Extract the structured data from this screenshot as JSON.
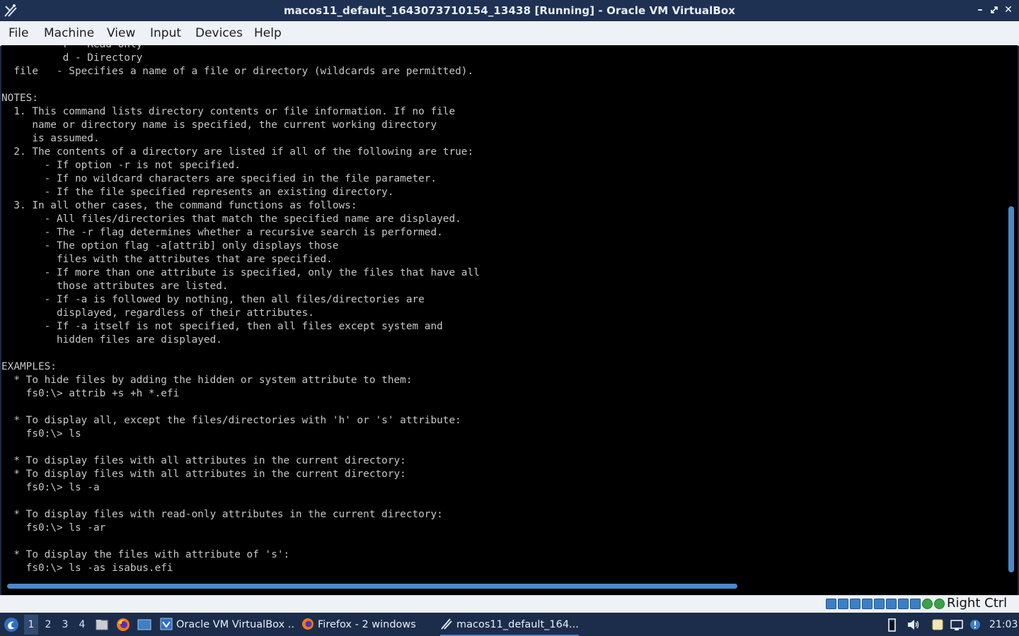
{
  "window": {
    "title": "macos11_default_1643073710154_13438 [Running] - Oracle VM VirtualBox"
  },
  "menubar": {
    "items": [
      "File",
      "Machine",
      "View",
      "Input",
      "Devices",
      "Help"
    ]
  },
  "terminal": {
    "lines": [
      "          r - Read Only",
      "          d - Directory",
      "  file   - Specifies a name of a file or directory (wildcards are permitted).",
      "",
      "NOTES:",
      "  1. This command lists directory contents or file information. If no file",
      "     name or directory name is specified, the current working directory",
      "     is assumed.",
      "  2. The contents of a directory are listed if all of the following are true:",
      "       - If option -r is not specified.",
      "       - If no wildcard characters are specified in the file parameter.",
      "       - If the file specified represents an existing directory.",
      "  3. In all other cases, the command functions as follows:",
      "       - All files/directories that match the specified name are displayed.",
      "       - The -r flag determines whether a recursive search is performed.",
      "       - The option flag -a[attrib] only displays those",
      "         files with the attributes that are specified.",
      "       - If more than one attribute is specified, only the files that have all",
      "         those attributes are listed.",
      "       - If -a is followed by nothing, then all files/directories are",
      "         displayed, regardless of their attributes.",
      "       - If -a itself is not specified, then all files except system and",
      "         hidden files are displayed.",
      "",
      "EXAMPLES:",
      "  * To hide files by adding the hidden or system attribute to them:",
      "    fs0:\\> attrib +s +h *.efi",
      "",
      "  * To display all, except the files/directories with 'h' or 's' attribute:",
      "    fs0:\\> ls",
      "",
      "  * To display files with all attributes in the current directory:",
      "  * To display files with all attributes in the current directory:",
      "    fs0:\\> ls -a",
      "",
      "  * To display files with read-only attributes in the current directory:",
      "    fs0:\\> ls -ar",
      "",
      "  * To display the files with attribute of 's':",
      "    fs0:\\> ls -as isabus.efi"
    ]
  },
  "statusbar": {
    "host_key": "Right Ctrl",
    "icons": [
      "hard-disk-icon",
      "optical-drive-icon",
      "audio-icon",
      "network-icon",
      "usb-icon",
      "shared-folders-icon",
      "display-icon",
      "video-capture-icon",
      "mouse-integration-icon",
      "cpu-activity-icon"
    ]
  },
  "taskbar": {
    "workspaces": [
      "1",
      "2",
      "3",
      "4"
    ],
    "tasks": [
      {
        "label": "Oracle VM VirtualBox ...",
        "icon": "virtualbox-icon"
      },
      {
        "label": "Firefox - 2 windows",
        "icon": "firefox-icon"
      },
      {
        "label": "macos11_default_164...",
        "icon": "vm-icon"
      }
    ],
    "clock": "21:03"
  },
  "colors": {
    "titlebar": "#1f3152",
    "taskbar": "#1c2d4b",
    "terminal_text": "#c7c7c7",
    "scrollbar": "#4a8ac9"
  }
}
